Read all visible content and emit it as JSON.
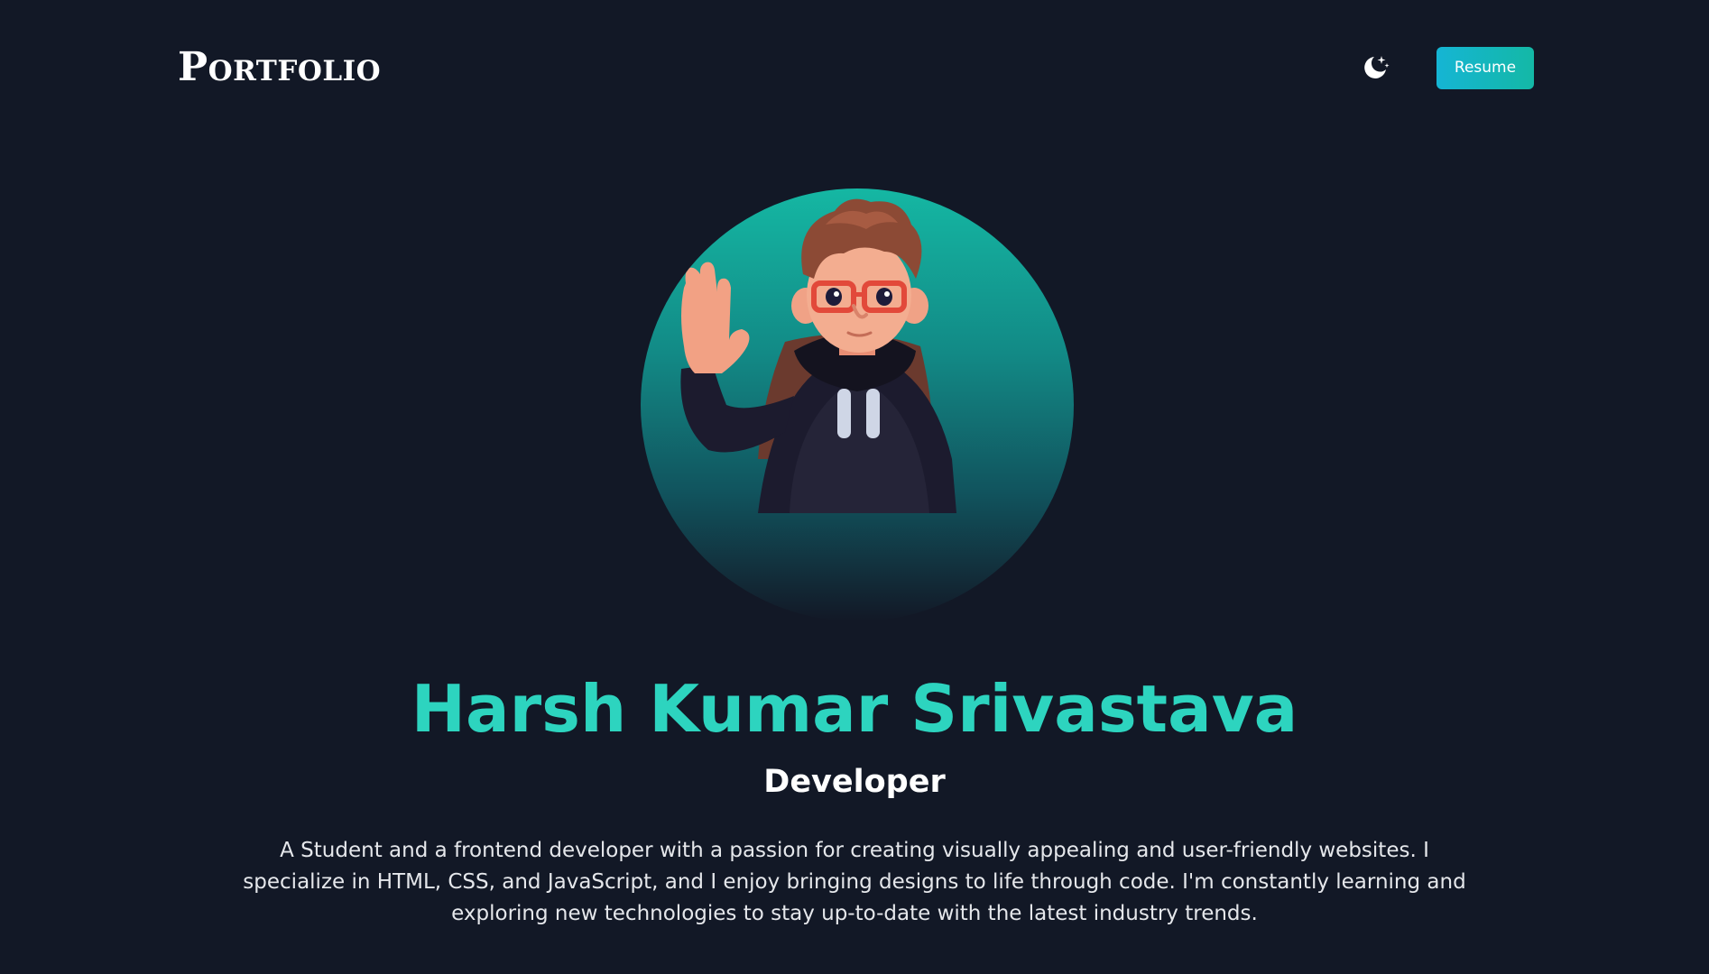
{
  "header": {
    "logo": "Portfolio",
    "theme_toggle_icon": "moon-stars-icon",
    "resume_label": "Resume"
  },
  "hero": {
    "avatar_icon": "waving-character-avatar",
    "name": "Harsh Kumar Srivastava",
    "role": "Developer",
    "bio": "A Student and a frontend developer with a passion for creating visually appealing and user-friendly websites. I specialize in HTML, CSS, and JavaScript, and I enjoy bringing designs to life through code. I'm constantly learning and exploring new technologies to stay up-to-date with the latest industry trends."
  },
  "colors": {
    "background": "#121826",
    "accent": "#2dd4bf",
    "button": "#14b8c8"
  }
}
